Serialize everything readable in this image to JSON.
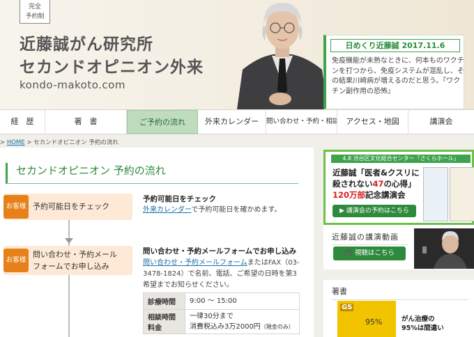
{
  "header": {
    "kanzen_line1": "完全",
    "kanzen_line2": "予約制",
    "title_line1": "近藤誠がん研究所",
    "title_line2": "セカンドオピニオン外来",
    "url": "kondo-makoto.com",
    "himekuri_title": "日めくり近藤誠 2017.11.6",
    "himekuri_body": "免疫機能が未熟なときに、何本ものワクチンを打つから、免疫システムが混乱し、その結果川崎病が増えるのだと思う。『ワクチン副作用の恐怖』"
  },
  "nav": {
    "items": [
      {
        "label": "経　歴"
      },
      {
        "label": "著　書"
      },
      {
        "label": "ご予約の流れ"
      },
      {
        "label": "外来カレンダー"
      },
      {
        "label": "問い合わせ・予約・相談票"
      },
      {
        "label": "アクセス・地図"
      },
      {
        "label": "講演会"
      }
    ]
  },
  "breadcrumb": {
    "home": "HOME",
    "sep": " > ",
    "current": "セカンドオピニオン 予約の流れ"
  },
  "main": {
    "title": "セカンドオピニオン 予約の流れ",
    "step1": {
      "badge": "お客様",
      "text": "予約可能日をチェック",
      "detail_title": "予約可能日をチェック",
      "detail_link": "外来カレンダー",
      "detail_rest": "で予約可能日を確かめます。"
    },
    "step2": {
      "badge": "お客様",
      "text_line1": "問い合わせ・予約メール",
      "text_line2": "フォームでお申し込み",
      "detail_title": "問い合わせ・予約メールフォームでお申し込み",
      "detail_link": "問い合わせ・予約メールフォーム",
      "detail_rest": "またはFAX（03-3478-1824）で名前、電話、ご希望の日時を第3希望までお知らせください。"
    },
    "table": {
      "row1_label": "診療時間",
      "row1_value": "9:00 ～ 15:00",
      "row2_label_line1": "相談時間",
      "row2_label_line2": "料金",
      "row2_value_line1": "一律30分まで",
      "row2_value_line2": "消費税込み3万2000円",
      "row2_value_note": "（現金のみ）"
    }
  },
  "sidebar": {
    "promo": {
      "head": "4.8 渋谷区文化総合センター「さくらホール」",
      "title_part1": "近藤誠「医者&クスリに殺されない",
      "title_red": "47",
      "title_part2": "の心得」",
      "title_line3_red": "120万部",
      "title_line3_rest": "記念講演会",
      "button": "講演会の予約はこちら"
    },
    "video": {
      "label": "近藤誠の講演動画",
      "button": "視聴はこちら"
    },
    "books": {
      "label": "著書",
      "cover_gs": "GS",
      "cover_num": "95%",
      "text_line1": "がん治療の",
      "text_line2": "95%は間違い"
    }
  },
  "colors": {
    "accent_green": "#3fa34d",
    "badge_orange": "#e8801a",
    "link_blue": "#1b6ea8"
  }
}
